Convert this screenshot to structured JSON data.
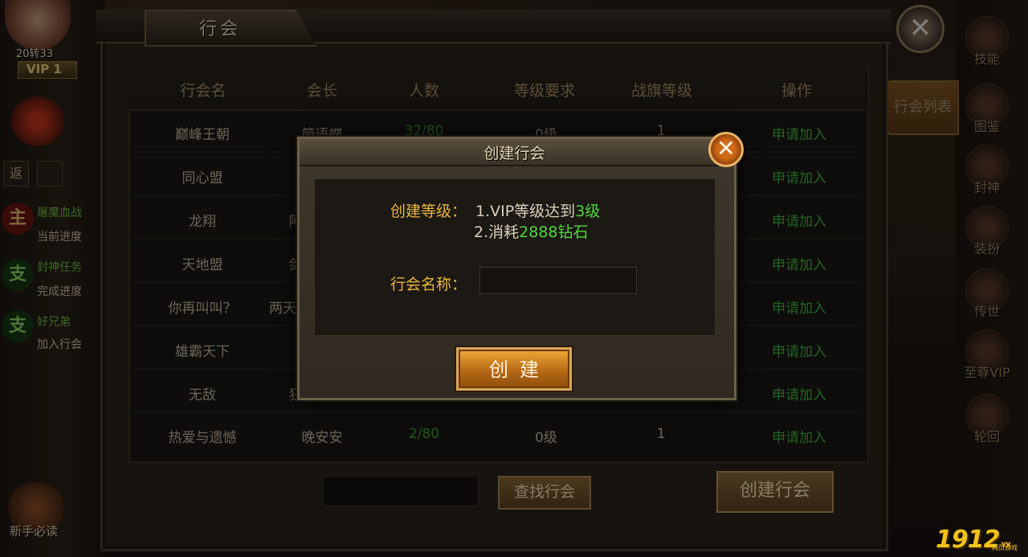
{
  "hud": {
    "level_text": "20转33",
    "vip_text": "VIP 1",
    "quest_tab_icon": "返",
    "quests": [
      {
        "badge": "主",
        "title": "屠魔血战",
        "sub": "当前进度"
      },
      {
        "badge": "支",
        "title": "封神任务",
        "sub": "完成进度"
      },
      {
        "badge": "支",
        "title": "好兄弟",
        "sub": "加入行会"
      }
    ],
    "newbie_label": "新手必读"
  },
  "side_menu": {
    "tab_label": "行会列表",
    "items": [
      "技能",
      "图鉴",
      "封神",
      "装扮",
      "传世",
      "至尊VIP",
      "轮回"
    ]
  },
  "guild_panel": {
    "title": "行会",
    "close_icon": "✕",
    "columns": [
      "行会名",
      "会长",
      "人数",
      "等级要求",
      "战旗等级",
      "操作"
    ],
    "rows": [
      {
        "name": "巅峰王朝",
        "leader": "简语蝶",
        "members": "32/80",
        "level_req": "0级",
        "flag_level": "1",
        "action": "申请加入"
      },
      {
        "name": "同心盟",
        "leader": "",
        "members": "",
        "level_req": "",
        "flag_level": "",
        "action": "申请加入"
      },
      {
        "name": "龙翔",
        "leader": "阿",
        "members": "",
        "level_req": "",
        "flag_level": "",
        "action": "申请加入"
      },
      {
        "name": "天地盟",
        "leader": "剑",
        "members": "",
        "level_req": "",
        "flag_level": "",
        "action": "申请加入"
      },
      {
        "name": "你再叫叫？",
        "leader": "两天",
        "members": "",
        "level_req": "",
        "flag_level": "",
        "action": "申请加入"
      },
      {
        "name": "雄霸天下",
        "leader": "",
        "members": "",
        "level_req": "",
        "flag_level": "",
        "action": "申请加入"
      },
      {
        "name": "无敌",
        "leader": "狂",
        "members": "",
        "level_req": "",
        "flag_level": "",
        "action": "申请加入"
      },
      {
        "name": "热爱与遗憾",
        "leader": "晚安安",
        "members": "2/80",
        "level_req": "0级",
        "flag_level": "1",
        "action": "申请加入"
      }
    ],
    "search_placeholder": "",
    "search_button": "查找行会",
    "create_button": "创建行会"
  },
  "modal": {
    "title": "创建行会",
    "close_icon": "✕",
    "req_label": "创建等级：",
    "req1_prefix": "1.VIP等级达到",
    "req1_value": "3级",
    "req2_prefix": "2.消耗",
    "req2_value": "2888钻石",
    "name_label": "行会名称：",
    "name_value": "",
    "name_placeholder": "",
    "create_button": "创建"
  },
  "watermark": {
    "text": "1912",
    "tag": "YX",
    "sub": "网页游戏"
  },
  "colors": {
    "accent_gold": "#e8b53c",
    "action_green": "#40b33d",
    "highlight_green": "#4fd63d",
    "button_orange": "#b76a16"
  }
}
